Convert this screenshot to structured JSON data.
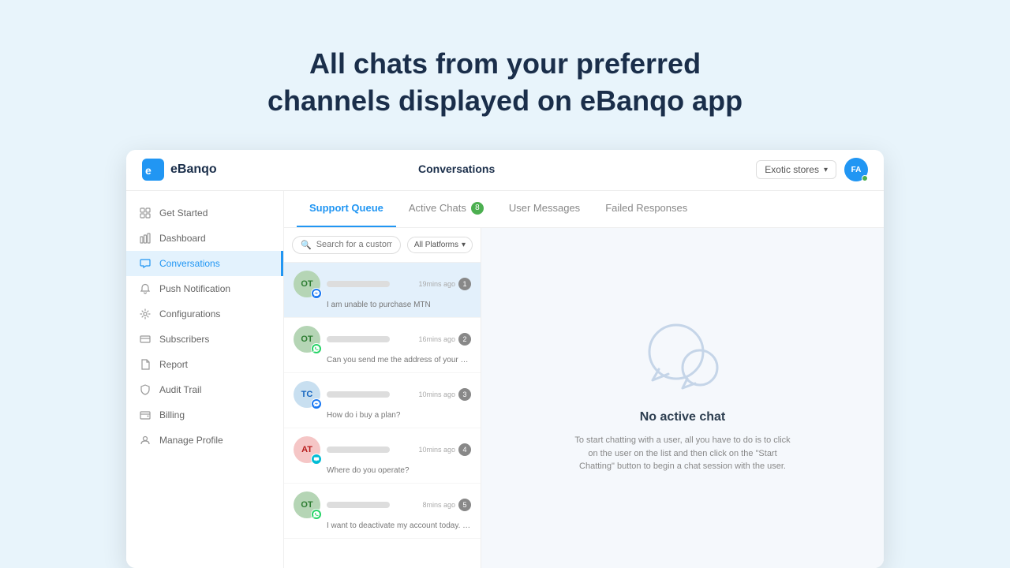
{
  "hero": {
    "line1": "All chats from your preferred",
    "line2": "channels displayed on eBanqo app"
  },
  "topbar": {
    "logo_text": "eBanqo",
    "page_title": "Conversations",
    "store_label": "Exotic stores",
    "avatar_initials": "FA"
  },
  "sidebar": {
    "items": [
      {
        "id": "get-started",
        "label": "Get Started",
        "icon": "grid"
      },
      {
        "id": "dashboard",
        "label": "Dashboard",
        "icon": "bar-chart"
      },
      {
        "id": "conversations",
        "label": "Conversations",
        "icon": "chat",
        "active": true
      },
      {
        "id": "push-notification",
        "label": "Push Notification",
        "icon": "bell"
      },
      {
        "id": "configurations",
        "label": "Configurations",
        "icon": "settings"
      },
      {
        "id": "subscribers",
        "label": "Subscribers",
        "icon": "credit-card"
      },
      {
        "id": "report",
        "label": "Report",
        "icon": "file"
      },
      {
        "id": "audit-trail",
        "label": "Audit Trail",
        "icon": "shield"
      },
      {
        "id": "billing",
        "label": "Billing",
        "icon": "wallet"
      },
      {
        "id": "manage-profile",
        "label": "Manage Profile",
        "icon": "user"
      }
    ]
  },
  "tabs": [
    {
      "id": "support-queue",
      "label": "Support Queue",
      "active": true
    },
    {
      "id": "active-chats",
      "label": "Active Chats",
      "badge": "8"
    },
    {
      "id": "user-messages",
      "label": "User Messages"
    },
    {
      "id": "failed-responses",
      "label": "Failed Responses"
    }
  ],
  "search": {
    "placeholder": "Search for a customer"
  },
  "filter": {
    "label": "All Platforms"
  },
  "chats": [
    {
      "initials": "OT",
      "message": "I am unable to purchase MTN",
      "time": "19mins ago",
      "platform": "messenger",
      "badge": "1",
      "active": true
    },
    {
      "initials": "OT",
      "message": "Can you send me the address of your office?",
      "time": "16mins ago",
      "platform": "whatsapp",
      "badge": "2"
    },
    {
      "initials": "TC",
      "message": "How do i buy a plan?",
      "time": "10mins ago",
      "platform": "messenger",
      "badge": "3"
    },
    {
      "initials": "AT",
      "message": "Where do you operate?",
      "time": "10mins ago",
      "platform": "chat",
      "badge": "4"
    },
    {
      "initials": "OT",
      "message": "I want to deactivate my account today. How can I?",
      "time": "8mins ago",
      "platform": "whatsapp",
      "badge": "5"
    }
  ],
  "empty_state": {
    "title": "No active chat",
    "description": "To start chatting with a user, all you have to do is to click on the user on the list and then click on the \"Start Chatting\" button to begin a chat session with the user."
  }
}
